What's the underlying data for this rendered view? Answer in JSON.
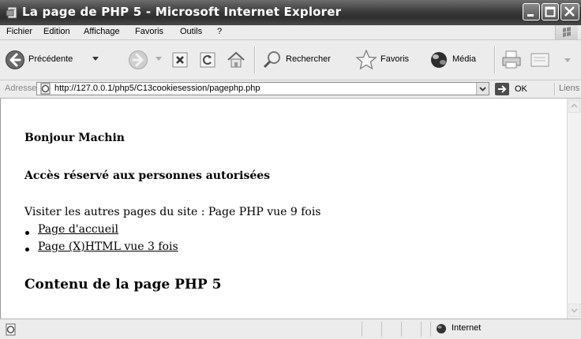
{
  "window": {
    "title": "La page de PHP 5 - Microsoft Internet Explorer"
  },
  "menu": [
    "Fichier",
    "Edition",
    "Affichage",
    "Favoris",
    "Outils",
    "?"
  ],
  "toolbar": {
    "back_label": "Précédente",
    "search_label": "Rechercher",
    "favorites_label": "Favoris",
    "media_label": "Média"
  },
  "address": {
    "label": "Adresse",
    "url": "http://127.0.0.1/php5/C13cookiesession/pagephp.php",
    "go_label": "OK",
    "links_label": "Liens"
  },
  "content": {
    "greeting": "Bonjour Machin",
    "access_notice": "Accès réservé aux personnes autorisées",
    "visit_text": "Visiter les autres pages du site : Page PHP vue 9 fois",
    "links": [
      "Page d'accueil",
      "Page (X)HTML vue 3 fois"
    ],
    "heading": "Contenu de la page PHP 5"
  },
  "status": {
    "zone": "Internet"
  }
}
